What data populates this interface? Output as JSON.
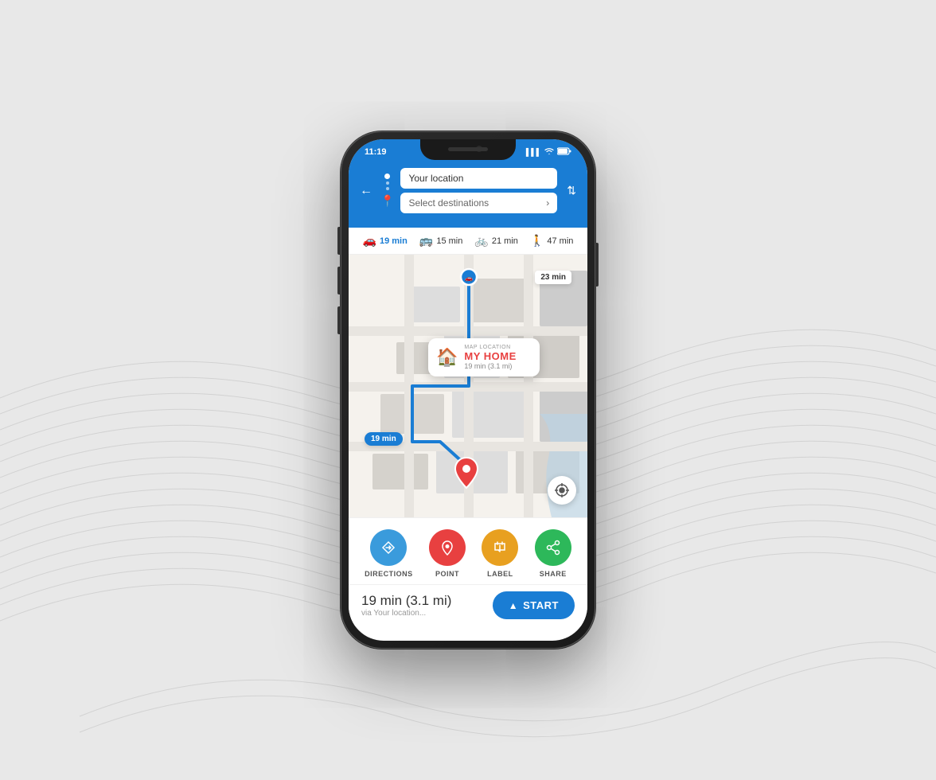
{
  "background": {
    "color": "#e8e8e8"
  },
  "statusBar": {
    "time": "11:19",
    "signal": "▌▌▌",
    "wifi": "WiFi",
    "battery": "🔋"
  },
  "header": {
    "backLabel": "←",
    "locationInput": "Your location",
    "destinationInput": "Select destinations",
    "swapLabel": "⇅"
  },
  "transportModes": [
    {
      "icon": "🚗",
      "time": "19 min",
      "active": true
    },
    {
      "icon": "🚌",
      "time": "15 min",
      "active": false
    },
    {
      "icon": "🚲",
      "time": "21 min",
      "active": false
    },
    {
      "icon": "🚶",
      "time": "47 min",
      "active": false
    }
  ],
  "map": {
    "popup": {
      "labelSmall": "MAP LOCATION",
      "title": "MY HOME",
      "subtitle": "19 min (3.1 mi)"
    },
    "timeLabelTop": "23 min",
    "timeLabelBottom": "19 min",
    "gpsIcon": "⊕"
  },
  "actions": [
    {
      "id": "directions",
      "icon": "◈",
      "label": "DIRECTIONS",
      "color": "#3a9bdc"
    },
    {
      "id": "point",
      "icon": "📍",
      "label": "POINT",
      "color": "#e84040"
    },
    {
      "id": "label",
      "icon": "🚩",
      "label": "LABEL",
      "color": "#e8a020"
    },
    {
      "id": "share",
      "icon": "↗",
      "label": "SHARE",
      "color": "#2db85a"
    }
  ],
  "bottomBar": {
    "time": "19 min",
    "distance": "(3.1 mi)",
    "via": "via Your location...",
    "startButton": "START"
  }
}
